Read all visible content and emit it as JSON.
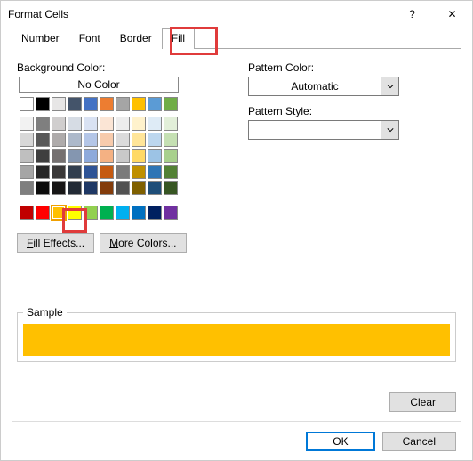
{
  "titlebar": {
    "title": "Format Cells",
    "help": "?",
    "close": "✕"
  },
  "tabs": [
    "Number",
    "Font",
    "Border",
    "Fill"
  ],
  "active_tab": "Fill",
  "labels": {
    "bgcolor": "Background Color:",
    "nocolor": "No Color",
    "pcolor": "Pattern Color:",
    "pstyle": "Pattern Style:",
    "sample": "Sample"
  },
  "buttons": {
    "fill_effects": "Fill Effects...",
    "more_colors": "More Colors...",
    "clear": "Clear",
    "ok": "OK",
    "cancel": "Cancel"
  },
  "pattern_color": {
    "selected": "Automatic"
  },
  "sample_color": "#FFC000",
  "selected_swatch": "#FFC000",
  "swatch_rows": {
    "r0": [
      "#FFFFFF",
      "#000000",
      "#E7E6E6",
      "#44546A",
      "#4472C4",
      "#ED7D31",
      "#A5A5A5",
      "#FFC000",
      "#5B9BD5",
      "#70AD47"
    ],
    "r1": [
      "#F2F2F2",
      "#7F7F7F",
      "#D0CECE",
      "#D6DCE4",
      "#D9E2F3",
      "#FBE5D5",
      "#EDEDED",
      "#FFF2CC",
      "#DEEBF6",
      "#E2EFD9"
    ],
    "r2": [
      "#D8D8D8",
      "#595959",
      "#AEABAB",
      "#ADB9CA",
      "#B4C6E7",
      "#F7CBAC",
      "#DBDBDB",
      "#FFE599",
      "#BDD7EE",
      "#C5E0B3"
    ],
    "r3": [
      "#BFBFBF",
      "#3F3F3F",
      "#757070",
      "#8496B0",
      "#8EAADB",
      "#F4B183",
      "#C9C9C9",
      "#FFD965",
      "#9CC3E5",
      "#A8D08D"
    ],
    "r4": [
      "#A5A5A5",
      "#262626",
      "#3A3838",
      "#323F4F",
      "#2F5496",
      "#C55A11",
      "#7B7B7B",
      "#BF9000",
      "#2E75B5",
      "#538135"
    ],
    "r5": [
      "#7F7F7F",
      "#0C0C0C",
      "#171616",
      "#222A35",
      "#1F3864",
      "#833C0B",
      "#525252",
      "#7F6000",
      "#1E4E79",
      "#375623"
    ],
    "std": [
      "#C00000",
      "#FF0000",
      "#FFC000",
      "#FFFF00",
      "#92D050",
      "#00B050",
      "#00B0F0",
      "#0070C0",
      "#002060",
      "#7030A0"
    ]
  }
}
